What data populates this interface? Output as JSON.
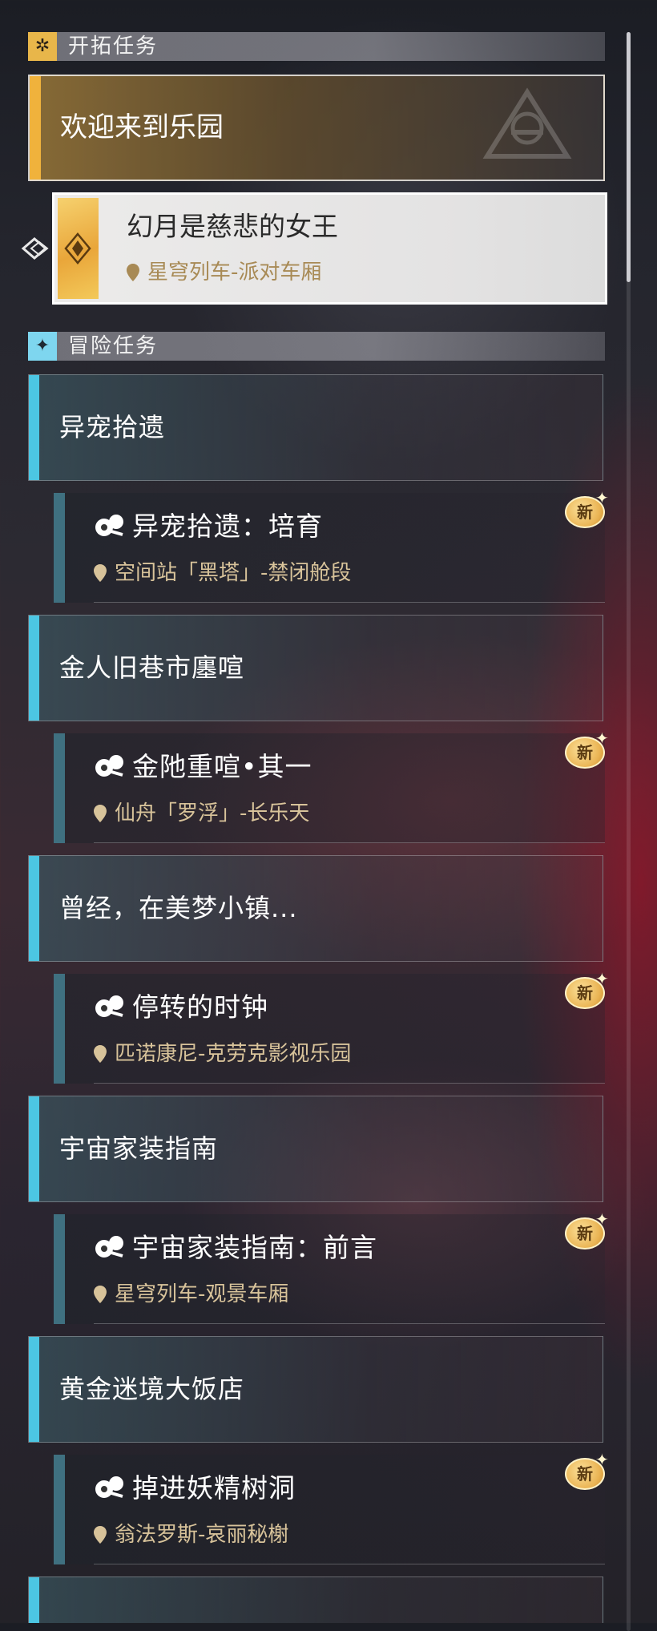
{
  "sections": {
    "trailblaze": {
      "label": "开拓任务",
      "icon": "trailblaze-icon"
    },
    "adventure": {
      "label": "冒险任务",
      "icon": "adventure-icon"
    }
  },
  "trailblaze_card": {
    "title": "欢迎来到乐园"
  },
  "selected_quest": {
    "title": "幻月是慈悲的女王",
    "location": "星穹列车-派对车厢"
  },
  "groups": [
    {
      "title": "异宠拾遗",
      "quest": {
        "title": "异宠拾遗：培育",
        "location": "空间站「黑塔」-禁闭舱段",
        "badge": "新"
      }
    },
    {
      "title": "金人旧巷市廛喧",
      "quest": {
        "title": "金阤重喧•其一",
        "location": "仙舟「罗浮」-长乐天",
        "badge": "新"
      }
    },
    {
      "title": "曾经，在美梦小镇...",
      "quest": {
        "title": "停转的时钟",
        "location": "匹诺康尼-克劳克影视乐园",
        "badge": "新"
      }
    },
    {
      "title": "宇宙家装指南",
      "quest": {
        "title": "宇宙家装指南：前言",
        "location": "星穹列车-观景车厢",
        "badge": "新"
      }
    },
    {
      "title": "黄金迷境大饭店",
      "quest": {
        "title": "掉进妖精树洞",
        "location": "翁法罗斯-哀丽秘榭",
        "badge": "新"
      }
    }
  ],
  "colors": {
    "gold": "#f0b23c",
    "cyan": "#4cc6e3",
    "location": "#d8c39a"
  }
}
